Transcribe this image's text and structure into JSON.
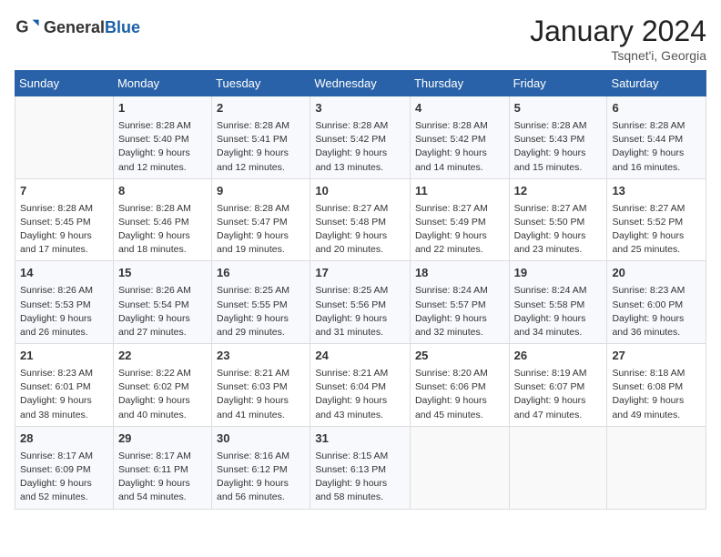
{
  "header": {
    "logo_general": "General",
    "logo_blue": "Blue",
    "month": "January 2024",
    "location": "Tsqnet'i, Georgia"
  },
  "days_of_week": [
    "Sunday",
    "Monday",
    "Tuesday",
    "Wednesday",
    "Thursday",
    "Friday",
    "Saturday"
  ],
  "weeks": [
    [
      {
        "day": "",
        "sunrise": "",
        "sunset": "",
        "daylight": ""
      },
      {
        "day": "1",
        "sunrise": "Sunrise: 8:28 AM",
        "sunset": "Sunset: 5:40 PM",
        "daylight": "Daylight: 9 hours and 12 minutes."
      },
      {
        "day": "2",
        "sunrise": "Sunrise: 8:28 AM",
        "sunset": "Sunset: 5:41 PM",
        "daylight": "Daylight: 9 hours and 12 minutes."
      },
      {
        "day": "3",
        "sunrise": "Sunrise: 8:28 AM",
        "sunset": "Sunset: 5:42 PM",
        "daylight": "Daylight: 9 hours and 13 minutes."
      },
      {
        "day": "4",
        "sunrise": "Sunrise: 8:28 AM",
        "sunset": "Sunset: 5:42 PM",
        "daylight": "Daylight: 9 hours and 14 minutes."
      },
      {
        "day": "5",
        "sunrise": "Sunrise: 8:28 AM",
        "sunset": "Sunset: 5:43 PM",
        "daylight": "Daylight: 9 hours and 15 minutes."
      },
      {
        "day": "6",
        "sunrise": "Sunrise: 8:28 AM",
        "sunset": "Sunset: 5:44 PM",
        "daylight": "Daylight: 9 hours and 16 minutes."
      }
    ],
    [
      {
        "day": "7",
        "sunrise": "Sunrise: 8:28 AM",
        "sunset": "Sunset: 5:45 PM",
        "daylight": "Daylight: 9 hours and 17 minutes."
      },
      {
        "day": "8",
        "sunrise": "Sunrise: 8:28 AM",
        "sunset": "Sunset: 5:46 PM",
        "daylight": "Daylight: 9 hours and 18 minutes."
      },
      {
        "day": "9",
        "sunrise": "Sunrise: 8:28 AM",
        "sunset": "Sunset: 5:47 PM",
        "daylight": "Daylight: 9 hours and 19 minutes."
      },
      {
        "day": "10",
        "sunrise": "Sunrise: 8:27 AM",
        "sunset": "Sunset: 5:48 PM",
        "daylight": "Daylight: 9 hours and 20 minutes."
      },
      {
        "day": "11",
        "sunrise": "Sunrise: 8:27 AM",
        "sunset": "Sunset: 5:49 PM",
        "daylight": "Daylight: 9 hours and 22 minutes."
      },
      {
        "day": "12",
        "sunrise": "Sunrise: 8:27 AM",
        "sunset": "Sunset: 5:50 PM",
        "daylight": "Daylight: 9 hours and 23 minutes."
      },
      {
        "day": "13",
        "sunrise": "Sunrise: 8:27 AM",
        "sunset": "Sunset: 5:52 PM",
        "daylight": "Daylight: 9 hours and 25 minutes."
      }
    ],
    [
      {
        "day": "14",
        "sunrise": "Sunrise: 8:26 AM",
        "sunset": "Sunset: 5:53 PM",
        "daylight": "Daylight: 9 hours and 26 minutes."
      },
      {
        "day": "15",
        "sunrise": "Sunrise: 8:26 AM",
        "sunset": "Sunset: 5:54 PM",
        "daylight": "Daylight: 9 hours and 27 minutes."
      },
      {
        "day": "16",
        "sunrise": "Sunrise: 8:25 AM",
        "sunset": "Sunset: 5:55 PM",
        "daylight": "Daylight: 9 hours and 29 minutes."
      },
      {
        "day": "17",
        "sunrise": "Sunrise: 8:25 AM",
        "sunset": "Sunset: 5:56 PM",
        "daylight": "Daylight: 9 hours and 31 minutes."
      },
      {
        "day": "18",
        "sunrise": "Sunrise: 8:24 AM",
        "sunset": "Sunset: 5:57 PM",
        "daylight": "Daylight: 9 hours and 32 minutes."
      },
      {
        "day": "19",
        "sunrise": "Sunrise: 8:24 AM",
        "sunset": "Sunset: 5:58 PM",
        "daylight": "Daylight: 9 hours and 34 minutes."
      },
      {
        "day": "20",
        "sunrise": "Sunrise: 8:23 AM",
        "sunset": "Sunset: 6:00 PM",
        "daylight": "Daylight: 9 hours and 36 minutes."
      }
    ],
    [
      {
        "day": "21",
        "sunrise": "Sunrise: 8:23 AM",
        "sunset": "Sunset: 6:01 PM",
        "daylight": "Daylight: 9 hours and 38 minutes."
      },
      {
        "day": "22",
        "sunrise": "Sunrise: 8:22 AM",
        "sunset": "Sunset: 6:02 PM",
        "daylight": "Daylight: 9 hours and 40 minutes."
      },
      {
        "day": "23",
        "sunrise": "Sunrise: 8:21 AM",
        "sunset": "Sunset: 6:03 PM",
        "daylight": "Daylight: 9 hours and 41 minutes."
      },
      {
        "day": "24",
        "sunrise": "Sunrise: 8:21 AM",
        "sunset": "Sunset: 6:04 PM",
        "daylight": "Daylight: 9 hours and 43 minutes."
      },
      {
        "day": "25",
        "sunrise": "Sunrise: 8:20 AM",
        "sunset": "Sunset: 6:06 PM",
        "daylight": "Daylight: 9 hours and 45 minutes."
      },
      {
        "day": "26",
        "sunrise": "Sunrise: 8:19 AM",
        "sunset": "Sunset: 6:07 PM",
        "daylight": "Daylight: 9 hours and 47 minutes."
      },
      {
        "day": "27",
        "sunrise": "Sunrise: 8:18 AM",
        "sunset": "Sunset: 6:08 PM",
        "daylight": "Daylight: 9 hours and 49 minutes."
      }
    ],
    [
      {
        "day": "28",
        "sunrise": "Sunrise: 8:17 AM",
        "sunset": "Sunset: 6:09 PM",
        "daylight": "Daylight: 9 hours and 52 minutes."
      },
      {
        "day": "29",
        "sunrise": "Sunrise: 8:17 AM",
        "sunset": "Sunset: 6:11 PM",
        "daylight": "Daylight: 9 hours and 54 minutes."
      },
      {
        "day": "30",
        "sunrise": "Sunrise: 8:16 AM",
        "sunset": "Sunset: 6:12 PM",
        "daylight": "Daylight: 9 hours and 56 minutes."
      },
      {
        "day": "31",
        "sunrise": "Sunrise: 8:15 AM",
        "sunset": "Sunset: 6:13 PM",
        "daylight": "Daylight: 9 hours and 58 minutes."
      },
      {
        "day": "",
        "sunrise": "",
        "sunset": "",
        "daylight": ""
      },
      {
        "day": "",
        "sunrise": "",
        "sunset": "",
        "daylight": ""
      },
      {
        "day": "",
        "sunrise": "",
        "sunset": "",
        "daylight": ""
      }
    ]
  ]
}
